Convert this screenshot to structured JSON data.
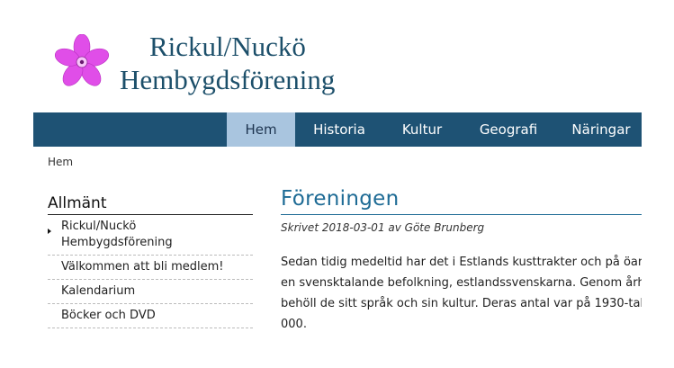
{
  "header": {
    "title_line1": "Rickul/Nuckö",
    "title_line2": "Hembygdsförening",
    "logo_icon": "pink-flower-icon",
    "logo_color": "#e04ee8"
  },
  "nav": {
    "items": [
      {
        "label": "Hem",
        "active": true
      },
      {
        "label": "Historia",
        "active": false
      },
      {
        "label": "Kultur",
        "active": false
      },
      {
        "label": "Geografi",
        "active": false
      },
      {
        "label": "Näringar",
        "active": false
      }
    ],
    "bar_color": "#1e5274",
    "active_color": "#a9c5df"
  },
  "breadcrumb": "Hem",
  "sidebar": {
    "heading": "Allmänt",
    "items": [
      {
        "line1": "Rickul/Nuckö",
        "line2": "Hembygdsförening"
      },
      {
        "line1": "Välkommen att bli medlem!"
      },
      {
        "line1": "Kalendarium"
      },
      {
        "line1": "Böcker och DVD"
      }
    ]
  },
  "article": {
    "title": "Föreningen",
    "byline": "Skrivet 2018-03-01 av Göte Brunberg",
    "lines": [
      "Sedan tidig medeltid har det i Estlands kusttrakter och på öar",
      "en svensktalande befolkning, estlandssvenskarna. Genom årh",
      "behöll de sitt språk och sin kultur. Deras antal var på 1930-tal",
      "000."
    ],
    "title_color": "#1e6b95"
  }
}
